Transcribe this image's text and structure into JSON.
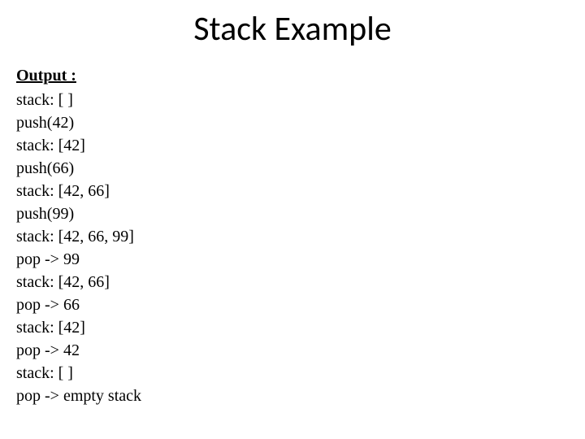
{
  "title": "Stack Example",
  "output_label": "Output :",
  "lines": [
    "stack: [ ]",
    "push(42)",
    "stack: [42]",
    "push(66)",
    "stack: [42, 66]",
    "push(99)",
    "stack: [42, 66, 99]",
    "pop -> 99",
    "stack: [42, 66]",
    "pop -> 66",
    "stack: [42]",
    "pop -> 42",
    "stack: [ ]",
    "pop -> empty stack"
  ]
}
